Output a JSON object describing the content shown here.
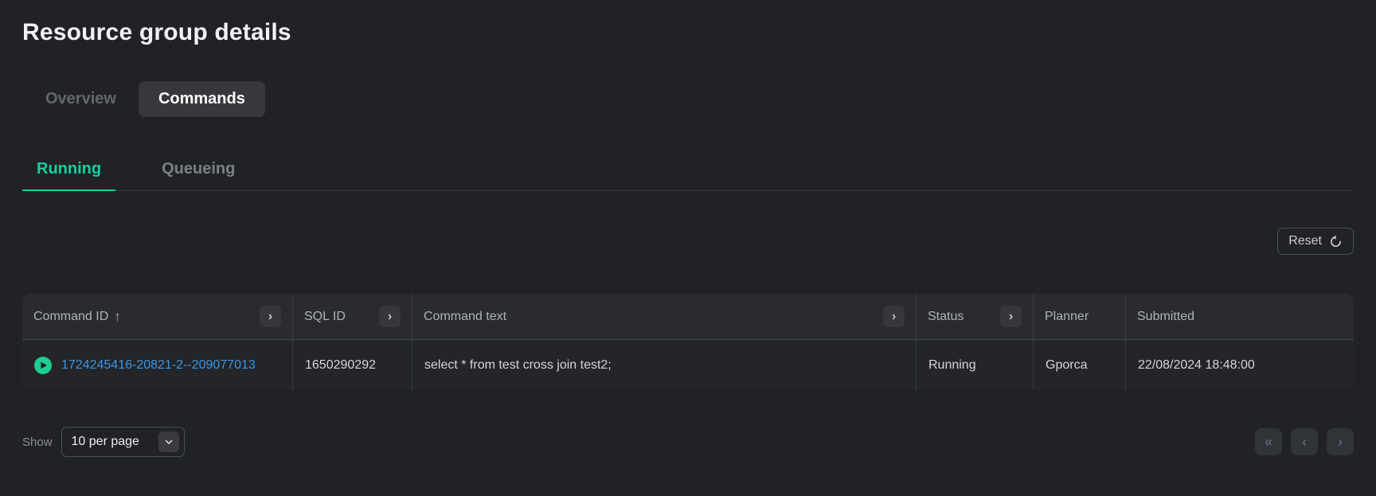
{
  "page": {
    "title": "Resource group details"
  },
  "tabs": {
    "overview": "Overview",
    "commands": "Commands",
    "active": "Commands"
  },
  "subtabs": {
    "running": "Running",
    "queueing": "Queueing",
    "active": "Running"
  },
  "toolbar": {
    "reset_label": "Reset"
  },
  "table": {
    "columns": [
      {
        "label": "Command ID",
        "sorted": "ascending",
        "expandable": true
      },
      {
        "label": "SQL ID",
        "expandable": true
      },
      {
        "label": "Command text",
        "expandable": true
      },
      {
        "label": "Status",
        "expandable": true
      },
      {
        "label": "Planner",
        "expandable": false
      },
      {
        "label": "Submitted",
        "expandable": false
      }
    ],
    "rows": [
      {
        "command_id": "1724245416-20821-2--209077013",
        "sql_id": "1650290292",
        "command_text": "select * from test cross join test2;",
        "status": "Running",
        "planner": "Gporca",
        "submitted": "22/08/2024 18:48:00"
      }
    ]
  },
  "footer": {
    "show_label": "Show",
    "page_size": "10 per page"
  },
  "icons": {
    "sort_asc": "↑",
    "expand": "›",
    "first_page": "«",
    "prev_page": "‹",
    "next_page": "›",
    "reset": "refresh-icon",
    "row_state": "play-icon",
    "select_caret": "chevron-down-icon"
  },
  "colors": {
    "accent_teal": "#13d0a0",
    "link_blue": "#3b96e8",
    "play_green": "#1fcd90",
    "background": "#212225",
    "table_header_bg": "#2a2b2e",
    "table_row_bg": "#232528"
  }
}
